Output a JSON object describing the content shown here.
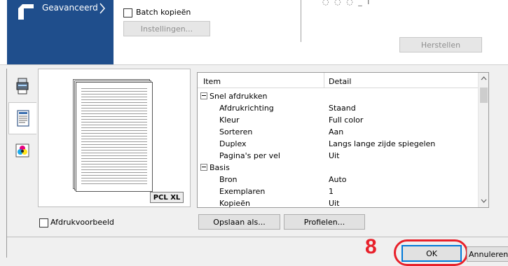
{
  "nav": {
    "label": "Geavanceerd"
  },
  "batch": {
    "checkbox_label": "Batch kopieën",
    "checked": false
  },
  "buttons": {
    "settings": "Instellingen...",
    "reset": "Herstellen",
    "save_as": "Opslaan als...",
    "profiles": "Profielen...",
    "ok": "OK",
    "cancel": "Annuleren"
  },
  "top_fragment": "◌ ◌ ◌ _ ı",
  "preview": {
    "pcl_badge": "PCL XL",
    "checkbox_label": "Afdrukvoorbeeld",
    "checked": false
  },
  "grid": {
    "columns": {
      "item": "Item",
      "detail": "Detail"
    },
    "rows": [
      {
        "type": "group",
        "item": "Snel afdrukken",
        "detail": ""
      },
      {
        "type": "row",
        "item": "Afdrukrichting",
        "detail": "Staand"
      },
      {
        "type": "row",
        "item": "Kleur",
        "detail": "Full color"
      },
      {
        "type": "row",
        "item": "Sorteren",
        "detail": "Aan"
      },
      {
        "type": "row",
        "item": "Duplex",
        "detail": "Langs lange zijde spiegelen"
      },
      {
        "type": "row",
        "item": "Pagina's per vel",
        "detail": "Uit"
      },
      {
        "type": "group",
        "item": "Basis",
        "detail": ""
      },
      {
        "type": "row",
        "item": "Bron",
        "detail": "Auto"
      },
      {
        "type": "row",
        "item": "Exemplaren",
        "detail": "1"
      },
      {
        "type": "row",
        "item": "Kopieën",
        "detail": "Uit"
      }
    ]
  },
  "annotation": {
    "step_number": "8"
  },
  "colors": {
    "nav_bg": "#1f4e8c",
    "annotation_red": "#e8202a",
    "focus_blue": "#0078d7"
  },
  "icons": [
    "arrow-icon",
    "chevron-right-icon",
    "printer-icon",
    "document-icon",
    "color-icon",
    "scroll-up-icon",
    "scroll-down-icon"
  ]
}
